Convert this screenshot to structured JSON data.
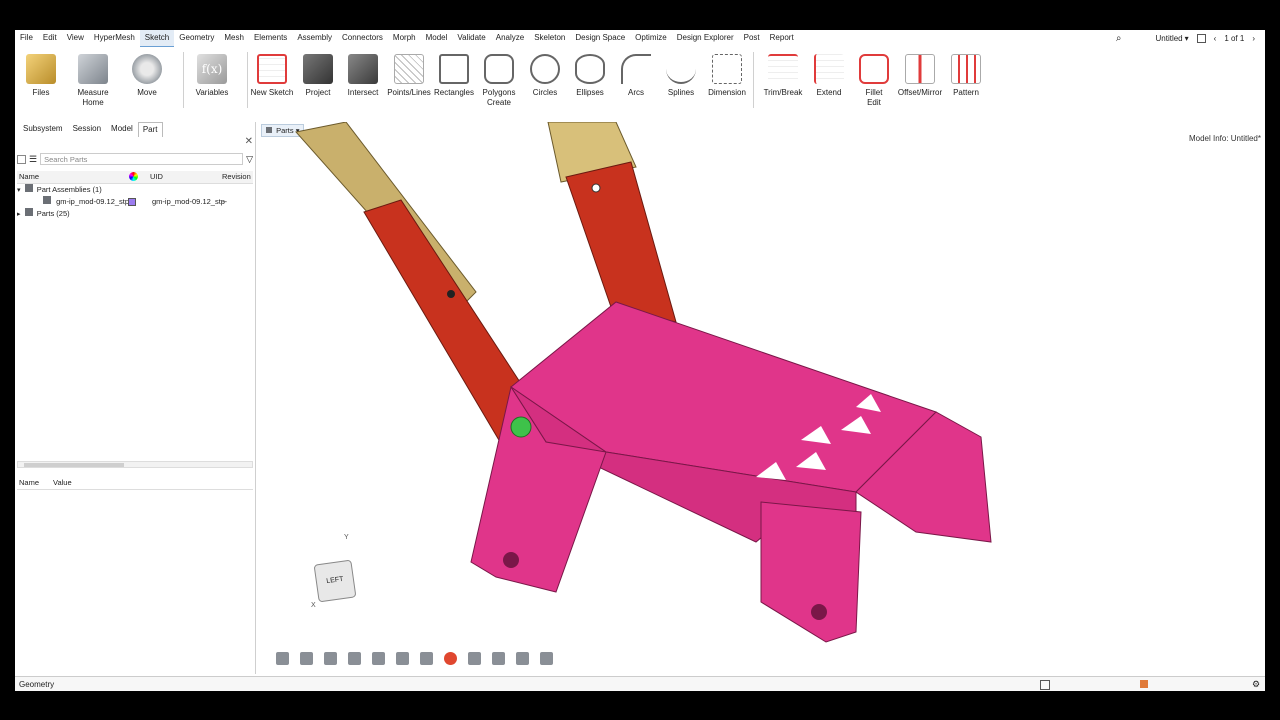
{
  "menubar": {
    "items": [
      "File",
      "Edit",
      "View",
      "HyperMesh",
      "Sketch",
      "Geometry",
      "Mesh",
      "Elements",
      "Assembly",
      "Connectors",
      "Morph",
      "Model",
      "Validate",
      "Analyze",
      "Skeleton",
      "Design Space",
      "Optimize",
      "Design Explorer",
      "Post",
      "Report"
    ],
    "active": "Sketch",
    "session_name": "Untitled",
    "page_count": "1 of 1"
  },
  "ribbon": {
    "files": "Files",
    "measure": "Measure",
    "home": "Home",
    "move": "Move",
    "variables": "Variables",
    "new_sketch": "New Sketch",
    "project": "Project",
    "intersect": "Intersect",
    "points_lines": "Points/Lines",
    "rectangles": "Rectangles",
    "polygons": "Polygons",
    "create": "Create",
    "circles": "Circles",
    "ellipses": "Ellipses",
    "arcs": "Arcs",
    "splines": "Splines",
    "dimension": "Dimension",
    "trim_break": "Trim/Break",
    "extend": "Extend",
    "fillet": "Fillet",
    "edit": "Edit",
    "offset_mirror": "Offset/Mirror",
    "pattern": "Pattern"
  },
  "browser": {
    "tabs": [
      "Subsystem",
      "Session",
      "Model",
      "Part"
    ],
    "active_tab": "Part",
    "search_placeholder": "Search Parts",
    "columns": {
      "name": "Name",
      "uid": "UID",
      "revision": "Revision"
    },
    "rows": [
      {
        "name": "Part Assemblies (1)"
      },
      {
        "name": "gm-ip_mod-09.12_stp",
        "uid": "gm-ip_mod-09.12_stp",
        "revision": "--"
      },
      {
        "name": "Parts (25)"
      }
    ],
    "props": {
      "name": "Name",
      "value": "Value"
    }
  },
  "viewport": {
    "parts_dropdown": "Parts",
    "model_info": "Model Info: Untitled*",
    "cube_label": "LEFT",
    "axis_y": "Y",
    "axis_x": "X"
  },
  "status": {
    "text": "Geometry"
  },
  "colors": {
    "accent": "#6a9fd4",
    "part_pink": "#e0358a",
    "part_red": "#c8321e",
    "part_tan": "#c8b070"
  }
}
